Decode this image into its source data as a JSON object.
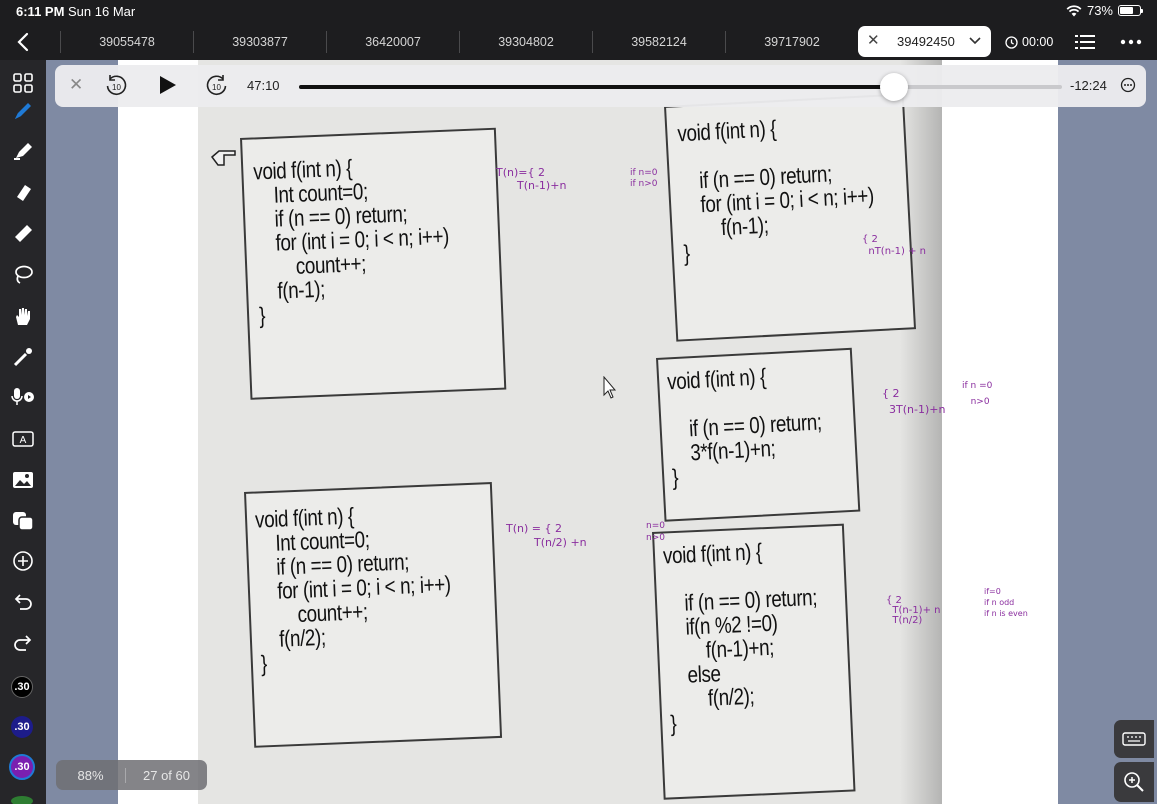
{
  "status": {
    "time": "6:11 PM",
    "date": "Sun 16 Mar",
    "battery": "73%",
    "battery_level": 0.73
  },
  "tabs": {
    "items": [
      "39055478",
      "39303877",
      "36420007",
      "39304802",
      "39582124",
      "39717902"
    ],
    "active": "39492450",
    "timer": "00:00"
  },
  "player": {
    "elapsed": "47:10",
    "remaining": "-12:24",
    "skip_back": "10",
    "skip_forward": "10",
    "progress": 0.78
  },
  "document": {
    "zoom": "88%",
    "page": "27 of 60",
    "code_blocks": [
      {
        "id": "a",
        "lines": [
          "void f(int n) {",
          "    Int count=0;",
          "    if (n == 0) return;",
          "    for (int i = 0; i < n; i++)",
          "        count++;",
          "    f(n-1);",
          "}"
        ]
      },
      {
        "id": "b",
        "lines": [
          "void f(int n) {",
          "",
          "    if (n == 0) return;",
          "    for (int i = 0; i < n; i++)",
          "        f(n-1);",
          "}"
        ]
      },
      {
        "id": "c",
        "lines": [
          "void f(int n) {",
          "",
          "    if (n == 0) return;",
          "    3*f(n-1)+n;",
          "}"
        ]
      },
      {
        "id": "d",
        "lines": [
          "void f(int n) {",
          "    Int count=0;",
          "    if (n == 0) return;",
          "    for (int i = 0; i < n; i++)",
          "        count++;",
          "    f(n/2);",
          "}"
        ]
      },
      {
        "id": "e",
        "lines": [
          "void f(int n) {",
          "",
          "    if (n == 0) return;",
          "    if(n %2 !=0)",
          "        f(n-1)+n;",
          "    else",
          "        f(n/2);",
          "}"
        ]
      }
    ],
    "notes": {
      "n1": "T(n)={ 2\n      T(n-1)+n",
      "n1_cond": "if n=0\nif n>0",
      "n2": "{ 2\n  nT(n-1) + n",
      "n3": "{ 2\n  3T(n-1)+n",
      "n3_cond": "if n =0\n   n>0",
      "n4": "T(n) = { 2\n        T(n/2) +n",
      "n4_cond": "n=0\nn>0",
      "n5": "{ 2\n  T(n-1)+ n\n  T(n/2)",
      "n5_cond": "if=0\nif n odd\nif n is even"
    }
  },
  "colors": {
    "ink": "#8a2e9f",
    "accent": "#1f7ad6",
    "workspace": "#7f8aa3"
  }
}
